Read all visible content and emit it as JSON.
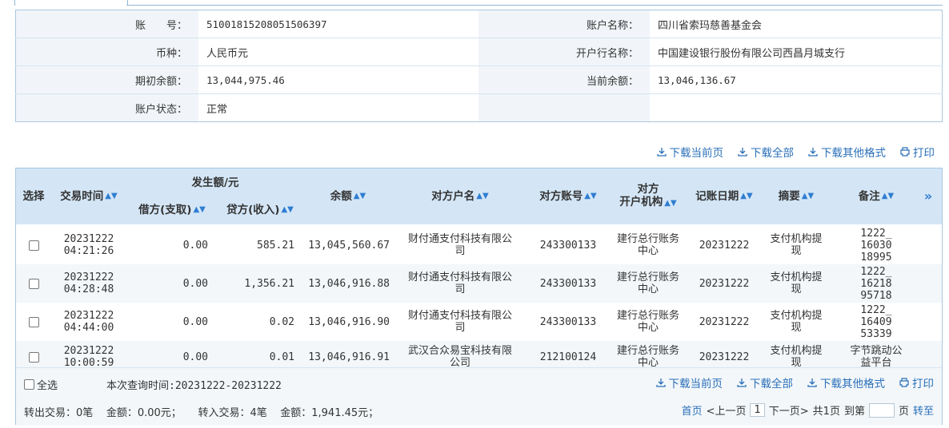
{
  "account": {
    "account_no_label": "账　　号：",
    "account_no": "51001815208051506397",
    "account_name_label": "账户名称：",
    "account_name": "四川省索玛慈善基金会",
    "currency_label": "币种：",
    "currency": "人民币元",
    "bank_label": "开户行名称：",
    "bank": "中国建设银行股份有限公司西昌月城支行",
    "opening_balance_label": "期初余额：",
    "opening_balance": "13,044,975.46",
    "current_balance_label": "当前余额：",
    "current_balance": "13,046,136.67",
    "status_label": "账户状态：",
    "status": "正常"
  },
  "actions": {
    "download_page": "下载当前页",
    "download_all": "下载全部",
    "download_other": "下载其他格式",
    "print": "打印"
  },
  "table": {
    "headers": {
      "select": "选择",
      "time": "交易时间",
      "amount_group": "发生额/元",
      "debit": "借方(支取)",
      "credit": "贷方(收入)",
      "balance": "余额",
      "counterparty_name": "对方户名",
      "counterparty_account": "对方账号",
      "counterparty_bank_line1": "对方",
      "counterparty_bank_line2": "开户机构",
      "post_date": "记账日期",
      "summary": "摘要",
      "remark": "备注",
      "more": "»"
    },
    "rows": [
      {
        "date": "20231222",
        "time": "04:21:26",
        "debit": "0.00",
        "credit": "585.21",
        "balance": "13,045,560.67",
        "cp_l1": "财付通支付科技有限公",
        "cp_l2": "司",
        "cp_account": "243300133",
        "bank_l1": "建行总行账务",
        "bank_l2": "中心",
        "post_date": "20231222",
        "sum_l1": "支付机构提",
        "sum_l2": "现",
        "rem_l1": "1222_",
        "rem_l2": "16030",
        "rem_l3": "18995"
      },
      {
        "date": "20231222",
        "time": "04:28:48",
        "debit": "0.00",
        "credit": "1,356.21",
        "balance": "13,046,916.88",
        "cp_l1": "财付通支付科技有限公",
        "cp_l2": "司",
        "cp_account": "243300133",
        "bank_l1": "建行总行账务",
        "bank_l2": "中心",
        "post_date": "20231222",
        "sum_l1": "支付机构提",
        "sum_l2": "现",
        "rem_l1": "1222_",
        "rem_l2": "16218",
        "rem_l3": "95718"
      },
      {
        "date": "20231222",
        "time": "04:44:00",
        "debit": "0.00",
        "credit": "0.02",
        "balance": "13,046,916.90",
        "cp_l1": "财付通支付科技有限公",
        "cp_l2": "司",
        "cp_account": "243300133",
        "bank_l1": "建行总行账务",
        "bank_l2": "中心",
        "post_date": "20231222",
        "sum_l1": "支付机构提",
        "sum_l2": "现",
        "rem_l1": "1222_",
        "rem_l2": "16409",
        "rem_l3": "53339"
      },
      {
        "date": "20231222",
        "time": "10:00:59",
        "debit": "0.00",
        "credit": "0.01",
        "balance": "13,046,916.91",
        "cp_l1": "武汉合众易宝科技有限",
        "cp_l2": "公司",
        "cp_account": "212100124",
        "bank_l1": "建行总行账务",
        "bank_l2": "中心",
        "post_date": "20231222",
        "sum_l1": "支付机构提",
        "sum_l2": "现",
        "rem_l1": "字节跳动公",
        "rem_l2": "益平台",
        "rem_l3": ""
      }
    ]
  },
  "footer": {
    "select_all": "全选",
    "query_time": "本次查询时间:20231222-20231222",
    "out_count": "转出交易：0笔",
    "out_amount": "金额：0.00元；",
    "in_count": "转入交易：4笔",
    "in_amount": "金额：1,941.45元；",
    "first": "首页",
    "prev": "<上一页",
    "page": "1",
    "next": "下一页>",
    "total": "共1页",
    "goto_prefix": "到第",
    "goto_suffix": "页",
    "goto": "转至"
  }
}
